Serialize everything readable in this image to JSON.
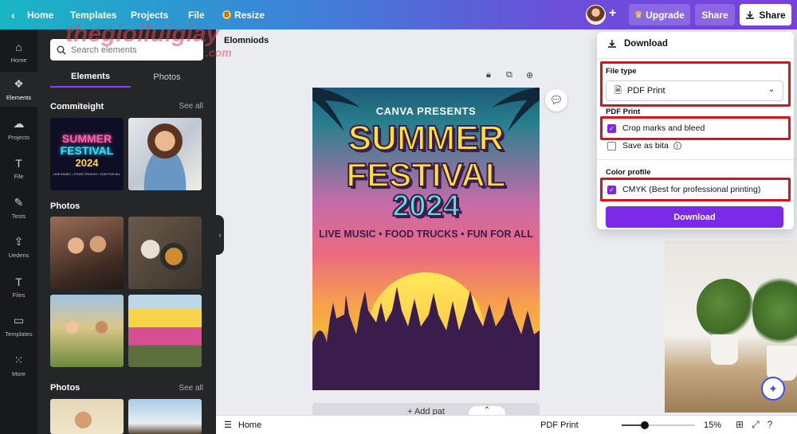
{
  "topbar": {
    "home": "Home",
    "templates": "Templates",
    "projects": "Projects",
    "file": "File",
    "resize": "Resize",
    "resize_badge": "B",
    "upgrade": "Upgrade",
    "share1": "Share",
    "share2": "Share",
    "plus": "+"
  },
  "rail": {
    "items": [
      {
        "label": "Home",
        "icon": "home-icon"
      },
      {
        "label": "Elements",
        "icon": "elements-icon"
      },
      {
        "label": "Projects",
        "icon": "cloud-icon"
      },
      {
        "label": "File",
        "icon": "text-icon"
      },
      {
        "label": "Tests",
        "icon": "draw-icon"
      },
      {
        "label": "Uedens",
        "icon": "upload-icon"
      },
      {
        "label": "Files",
        "icon": "text-icon"
      },
      {
        "label": "Templates",
        "icon": "folder-icon"
      },
      {
        "label": "More",
        "icon": "grid-icon"
      }
    ]
  },
  "watermark": {
    "line1": "thegioiluigiay",
    "line2": ".com"
  },
  "panel": {
    "search_placeholder": "Search elements",
    "tabs": {
      "elements": "Elements",
      "photos": "Photos"
    },
    "section1": {
      "title": "Commiteight",
      "see_all": "See all"
    },
    "section2": {
      "title": "Photos"
    },
    "section3": {
      "title": "Photos",
      "see_all": "See all"
    },
    "summer_thumb": {
      "line1": "SUMMER",
      "line2": "FESTIVAL",
      "line3": "2024",
      "line4": "LIVE MUSIC • FOOD TRUCKS • FUN FOR ALL"
    }
  },
  "canvas": {
    "doc_title": "Elomniods",
    "poster": {
      "presents": "CANVA PRESENTS",
      "line1": "SUMMER",
      "line2": "FESTIVAL",
      "line3": "2024",
      "tagline": "LIVE MUSIC • FOOD TRUCKS • FUN FOR ALL"
    },
    "add_page": "+ Add pat"
  },
  "download": {
    "header": "Download",
    "file_type_label": "File type",
    "file_type_value": "PDF Print",
    "pdf_print_label": "PDF Print",
    "crop_marks": "Crop marks and bleed",
    "crop_marks_checked": true,
    "save_as": "Save as bita",
    "save_as_checked": false,
    "color_profile_label": "Color profile",
    "cmyk": "CMYK (Best for professional printing)",
    "cmyk_checked": true,
    "button": "Download"
  },
  "bottombar": {
    "home": "Home",
    "pdf_print": "PDF Print",
    "zoom": "15%",
    "zoom_slider_fraction": 0.31
  },
  "colors": {
    "accent": "#7d2ae8",
    "highlight_box": "#e20f14"
  }
}
